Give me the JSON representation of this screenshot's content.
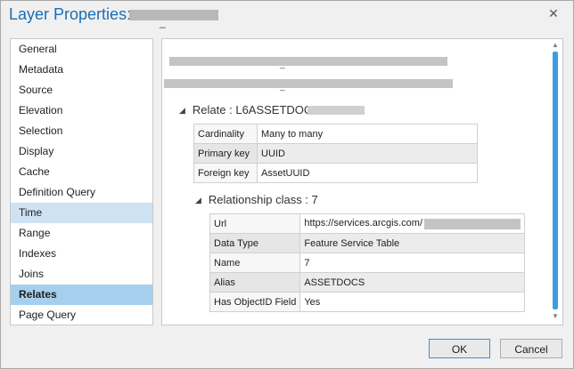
{
  "window": {
    "title": "Layer Properties:",
    "title_suffix": "_",
    "close_icon": "close-icon"
  },
  "nav": {
    "items": [
      {
        "label": "General",
        "state": "normal"
      },
      {
        "label": "Metadata",
        "state": "normal"
      },
      {
        "label": "Source",
        "state": "normal"
      },
      {
        "label": "Elevation",
        "state": "normal"
      },
      {
        "label": "Selection",
        "state": "normal"
      },
      {
        "label": "Display",
        "state": "normal"
      },
      {
        "label": "Cache",
        "state": "normal"
      },
      {
        "label": "Definition Query",
        "state": "normal"
      },
      {
        "label": "Time",
        "state": "hover"
      },
      {
        "label": "Range",
        "state": "normal"
      },
      {
        "label": "Indexes",
        "state": "normal"
      },
      {
        "label": "Joins",
        "state": "normal"
      },
      {
        "label": "Relates",
        "state": "selected"
      },
      {
        "label": "Page Query",
        "state": "normal"
      }
    ]
  },
  "content": {
    "redacted_marks": [
      "_",
      "_"
    ],
    "relate": {
      "heading": "Relate : L6ASSETDOC",
      "rows": [
        {
          "key": "Cardinality",
          "value": "Many to many"
        },
        {
          "key": "Primary key",
          "value": "UUID"
        },
        {
          "key": "Foreign key",
          "value": "AssetUUID"
        }
      ]
    },
    "relationship_class": {
      "heading": "Relationship class : 7",
      "rows": [
        {
          "key": "Url",
          "value": "https://services.arcgis.com/"
        },
        {
          "key": "Data Type",
          "value": "Feature Service Table"
        },
        {
          "key": "Name",
          "value": "7"
        },
        {
          "key": "Alias",
          "value": "ASSETDOCS"
        },
        {
          "key": "Has ObjectID Field",
          "value": "Yes"
        }
      ]
    }
  },
  "buttons": {
    "ok": "OK",
    "cancel": "Cancel"
  },
  "colors": {
    "title": "#1a6fb5",
    "selected": "#a6cfee",
    "hover": "#cfe2f3",
    "scroll_thumb": "#3b9ee3"
  }
}
